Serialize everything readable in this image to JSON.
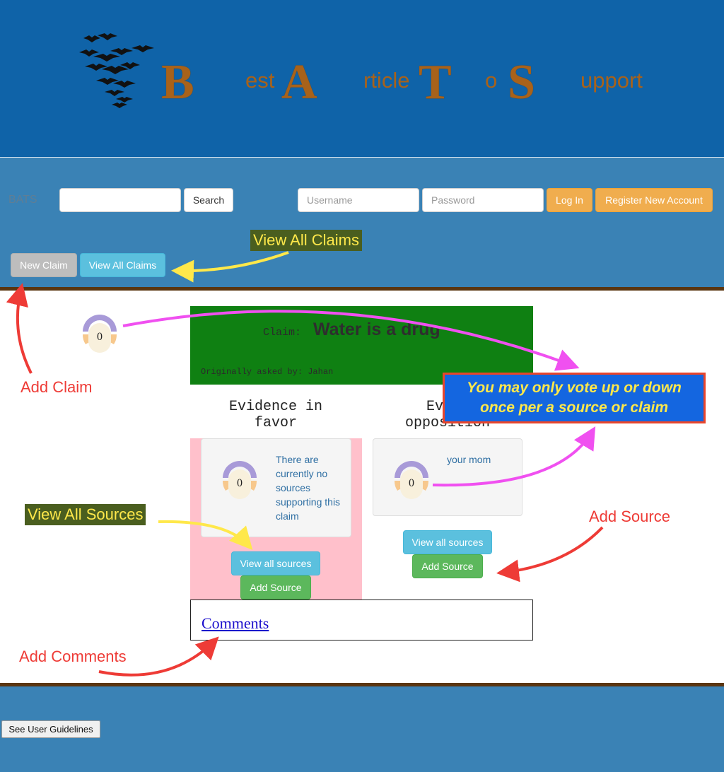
{
  "header": {
    "logo_icon": "bat-swarm-icon",
    "title_parts": [
      {
        "big": "B",
        "small": "est"
      },
      {
        "big": "A",
        "small": "rticle"
      },
      {
        "big": "T",
        "small": "o"
      },
      {
        "big": "S",
        "small": "upport"
      }
    ]
  },
  "nav": {
    "brand": "BATS",
    "search_value": "",
    "search_button": "Search",
    "username_placeholder": "Username",
    "password_placeholder": "Password",
    "login_button": "Log In",
    "register_button": "Register New Account",
    "new_claim_button": "New Claim",
    "view_all_claims_button": "View All Claims"
  },
  "claim": {
    "label": "Claim:",
    "title": "Water is a drug",
    "asked_by": "Originally asked by: Jahan",
    "votes": "0"
  },
  "favor": {
    "heading_line1": "Evidence in",
    "heading_line2": "favor",
    "votes": "0",
    "source_text_lines": [
      "There are",
      "currently no",
      "sources",
      "supporting this",
      "claim"
    ],
    "view_all_button": "View all sources",
    "add_source_button": "Add Source"
  },
  "opposition": {
    "heading_line1": "Evide",
    "heading_line2": "opposition",
    "votes": "0",
    "source_text": "your mom",
    "view_all_button": "View all sources",
    "add_source_button": "Add Source"
  },
  "comments": {
    "link": "Comments"
  },
  "footer": {
    "guidelines_button": "See User Guidelines"
  },
  "annotations": {
    "view_all_claims": "View All Claims",
    "add_claim": "Add Claim",
    "vote_note_line1": "You may only vote up or down",
    "vote_note_line2": "once per a source or claim",
    "view_all_sources": "View All Sources",
    "add_source": "Add Source",
    "add_comments": "Add Comments"
  },
  "colors": {
    "header_bg": "#0f63a8",
    "nav_bg": "#3a82b5",
    "title_brown": "#a8621a",
    "claim_green": "#0f8012",
    "favor_pink": "#ffc0cb",
    "annotation_red": "#ee3b36",
    "annotation_magenta": "#f050f0",
    "annotation_yellow": "#ffe84a"
  }
}
